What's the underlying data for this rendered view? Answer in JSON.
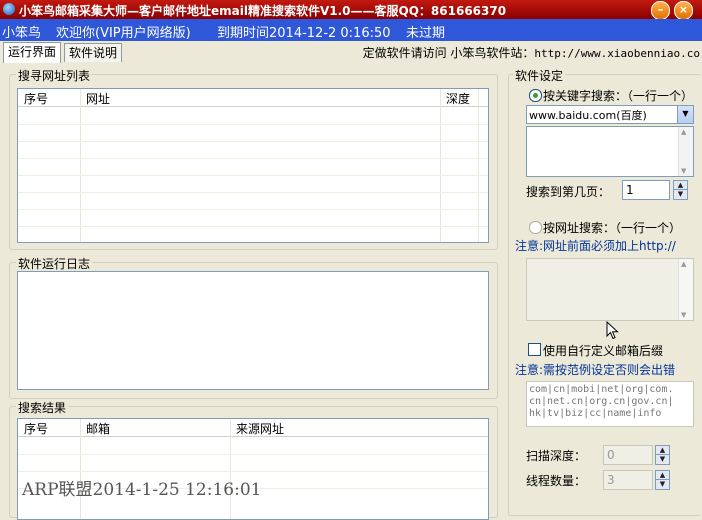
{
  "titlebar": {
    "title": "小笨鸟邮箱采集大师—客户邮件地址email精准搜索软件V1.0——客服QQ：861666370",
    "min_icon": "minimize-icon",
    "close_icon": "close-icon",
    "min_glyph": "–",
    "close_glyph": "×"
  },
  "welcome": {
    "brand": "小笨鸟",
    "greeting": "欢迎你(VIP用户网络版)",
    "expiry_label": "到期时间2014-12-2 0:16:50",
    "status": "未过期"
  },
  "tabs": [
    {
      "label": "运行界面",
      "active": true
    },
    {
      "label": "软件说明",
      "active": false
    }
  ],
  "links": {
    "custom": "定做软件请访问",
    "site_label": "小笨鸟软件站：",
    "site_url": "http://www.xiaobenniao.co"
  },
  "url_list": {
    "title": "搜寻网址列表",
    "columns": [
      "序号",
      "网址",
      "深度"
    ]
  },
  "log": {
    "title": "软件运行日志"
  },
  "results": {
    "title": "搜索结果",
    "columns": [
      "序号",
      "邮箱",
      "来源网址"
    ]
  },
  "settings": {
    "title": "软件设定",
    "keyword_search_label": "按关键字搜索：（一行一个）",
    "engine_selected": "www.baidu.com(百度)",
    "page_label": "搜索到第几页：",
    "page_value": "1",
    "url_search_label": "按网址搜索：（一行一个）",
    "url_note": "注意:网址前面必须加上http://",
    "custom_suffix_label": "使用自行定义邮箱后缀",
    "suffix_note": "注意:需按范例设定否则会出错",
    "suffix_example": [
      "com|cn|mobi|net|org|com.",
      "cn|net.cn|org.cn|gov.cn|",
      "hk|tv|biz|cc|name|info"
    ],
    "depth_label": "扫描深度：",
    "depth_value": "0",
    "threads_label": "线程数量：",
    "threads_value": "3"
  },
  "watermark": "ARP联盟2014-1-25 12:16:01"
}
